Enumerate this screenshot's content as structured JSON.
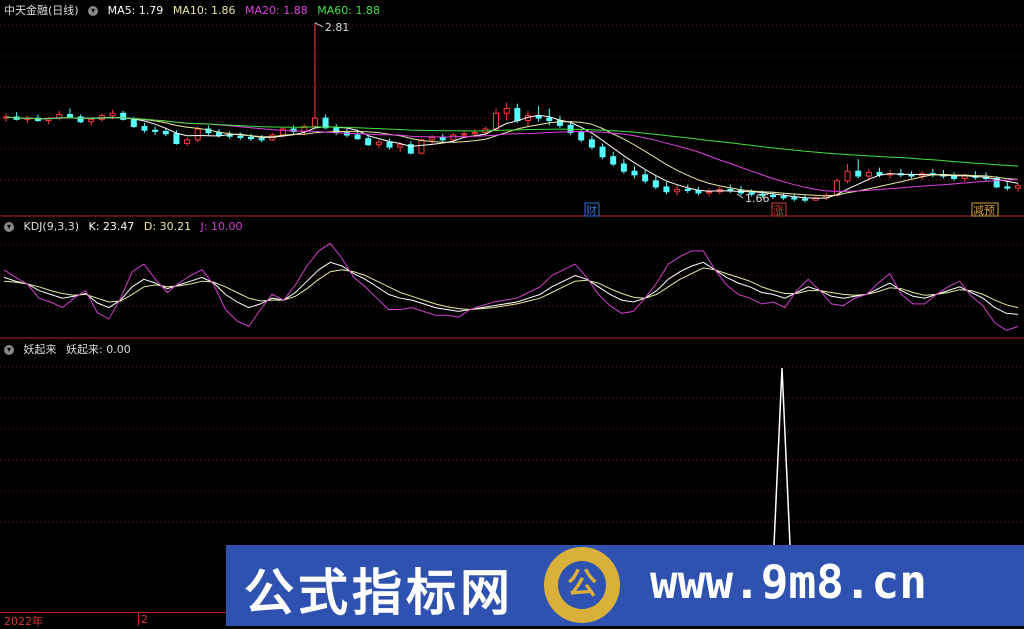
{
  "colors": {
    "up": "#ff3a3a",
    "down": "#54ffff",
    "ma5": "#ffffff",
    "ma10": "#e8e8a0",
    "ma20": "#e040e0",
    "ma60": "#40e040",
    "grid": "#7a1818",
    "panel_border": "#b22222",
    "kdj_k": "#ffffff",
    "kdj_d": "#e8e8a0",
    "kdj_j": "#d040d0"
  },
  "main_panel": {
    "title": "中天金融(日线)",
    "ma5_label": "MA5: 1.79",
    "ma10_label": "MA10: 1.86",
    "ma20_label": "MA20: 1.88",
    "ma60_label": "MA60: 1.88",
    "high_marker": "2.81",
    "low_marker": "1.66",
    "tags": [
      "财",
      "涨",
      "减预"
    ]
  },
  "kdj_panel": {
    "title": "KDJ(9,3,3)",
    "k_label": "K: 23.47",
    "d_label": "D: 30.21",
    "j_label": "J: 10.00"
  },
  "yao_panel": {
    "title": "妖起来",
    "value_label": "妖起来: 0.00"
  },
  "date_axis": {
    "year_label": "2022年",
    "month_label": "2"
  },
  "banner": {
    "cn_text": "公式指标网",
    "en_text": "www.9m8.cn",
    "logo_glyph": "公",
    "logo_subtext": "www.9m8.cn"
  },
  "chart_data": {
    "type": "candlestick",
    "ohlc": [
      [
        2.02,
        2.06,
        1.99,
        2.03
      ],
      [
        2.03,
        2.07,
        2.0,
        2.01
      ],
      [
        2.01,
        2.04,
        1.98,
        2.02
      ],
      [
        2.02,
        2.05,
        1.99,
        2.0
      ],
      [
        2.0,
        2.03,
        1.97,
        2.02
      ],
      [
        2.02,
        2.08,
        2.0,
        2.05
      ],
      [
        2.05,
        2.1,
        2.02,
        2.03
      ],
      [
        2.03,
        2.05,
        1.98,
        1.99
      ],
      [
        1.99,
        2.02,
        1.96,
        2.01
      ],
      [
        2.01,
        2.06,
        1.99,
        2.04
      ],
      [
        2.04,
        2.09,
        2.01,
        2.06
      ],
      [
        2.06,
        2.08,
        2.0,
        2.01
      ],
      [
        2.01,
        2.03,
        1.94,
        1.95
      ],
      [
        1.95,
        1.98,
        1.9,
        1.92
      ],
      [
        1.92,
        1.95,
        1.88,
        1.91
      ],
      [
        1.91,
        1.94,
        1.87,
        1.89
      ],
      [
        1.89,
        1.92,
        1.8,
        1.81
      ],
      [
        1.81,
        1.86,
        1.79,
        1.84
      ],
      [
        1.84,
        1.95,
        1.82,
        1.93
      ],
      [
        1.93,
        1.96,
        1.88,
        1.9
      ],
      [
        1.9,
        1.93,
        1.86,
        1.88
      ],
      [
        1.88,
        1.91,
        1.85,
        1.87
      ],
      [
        1.87,
        1.9,
        1.84,
        1.86
      ],
      [
        1.86,
        1.89,
        1.83,
        1.85
      ],
      [
        1.85,
        1.88,
        1.82,
        1.84
      ],
      [
        1.84,
        1.9,
        1.83,
        1.88
      ],
      [
        1.88,
        1.95,
        1.86,
        1.93
      ],
      [
        1.93,
        1.96,
        1.89,
        1.91
      ],
      [
        1.91,
        1.97,
        1.88,
        1.95
      ],
      [
        1.95,
        2.81,
        1.94,
        2.02
      ],
      [
        2.02,
        2.05,
        1.93,
        1.94
      ],
      [
        1.94,
        1.97,
        1.88,
        1.9
      ],
      [
        1.9,
        1.93,
        1.86,
        1.88
      ],
      [
        1.88,
        1.91,
        1.84,
        1.85
      ],
      [
        1.85,
        1.88,
        1.79,
        1.8
      ],
      [
        1.8,
        1.84,
        1.77,
        1.82
      ],
      [
        1.82,
        1.85,
        1.76,
        1.78
      ],
      [
        1.78,
        1.82,
        1.74,
        1.8
      ],
      [
        1.8,
        1.83,
        1.72,
        1.73
      ],
      [
        1.73,
        1.85,
        1.72,
        1.84
      ],
      [
        1.84,
        1.88,
        1.8,
        1.86
      ],
      [
        1.86,
        1.89,
        1.82,
        1.84
      ],
      [
        1.84,
        1.9,
        1.83,
        1.88
      ],
      [
        1.88,
        1.91,
        1.85,
        1.89
      ],
      [
        1.89,
        1.93,
        1.86,
        1.9
      ],
      [
        1.9,
        1.95,
        1.88,
        1.93
      ],
      [
        1.93,
        2.1,
        1.91,
        2.06
      ],
      [
        2.06,
        2.15,
        2.0,
        2.1
      ],
      [
        2.1,
        2.14,
        1.98,
        2.0
      ],
      [
        2.0,
        2.08,
        1.95,
        2.04
      ],
      [
        2.04,
        2.12,
        1.99,
        2.02
      ],
      [
        2.02,
        2.1,
        1.96,
        2.0
      ],
      [
        2.0,
        2.04,
        1.94,
        1.96
      ],
      [
        1.96,
        1.99,
        1.88,
        1.9
      ],
      [
        1.9,
        1.93,
        1.82,
        1.84
      ],
      [
        1.84,
        1.87,
        1.76,
        1.78
      ],
      [
        1.78,
        1.81,
        1.68,
        1.7
      ],
      [
        1.7,
        1.74,
        1.62,
        1.64
      ],
      [
        1.64,
        1.68,
        1.56,
        1.58
      ],
      [
        1.58,
        1.62,
        1.52,
        1.55
      ],
      [
        1.55,
        1.59,
        1.48,
        1.5
      ],
      [
        1.5,
        1.54,
        1.43,
        1.45
      ],
      [
        1.45,
        1.49,
        1.39,
        1.41
      ],
      [
        1.41,
        1.46,
        1.38,
        1.43
      ],
      [
        1.43,
        1.47,
        1.4,
        1.42
      ],
      [
        1.42,
        1.45,
        1.38,
        1.4
      ],
      [
        1.4,
        1.44,
        1.37,
        1.41
      ],
      [
        1.41,
        1.45,
        1.39,
        1.43
      ],
      [
        1.43,
        1.47,
        1.4,
        1.42
      ],
      [
        1.42,
        1.46,
        1.38,
        1.4
      ],
      [
        1.4,
        1.43,
        1.37,
        1.39
      ],
      [
        1.39,
        1.42,
        1.36,
        1.38
      ],
      [
        1.38,
        1.41,
        1.35,
        1.37
      ],
      [
        1.37,
        1.4,
        1.34,
        1.36
      ],
      [
        1.36,
        1.39,
        1.33,
        1.35
      ],
      [
        1.35,
        1.38,
        1.32,
        1.34
      ],
      [
        1.34,
        1.37,
        1.66,
        1.36
      ],
      [
        1.36,
        1.4,
        1.34,
        1.38
      ],
      [
        1.38,
        1.52,
        1.37,
        1.5
      ],
      [
        1.5,
        1.64,
        1.48,
        1.58
      ],
      [
        1.58,
        1.68,
        1.52,
        1.54
      ],
      [
        1.54,
        1.6,
        1.5,
        1.57
      ],
      [
        1.57,
        1.61,
        1.53,
        1.55
      ],
      [
        1.55,
        1.59,
        1.52,
        1.56
      ],
      [
        1.56,
        1.6,
        1.53,
        1.55
      ],
      [
        1.55,
        1.58,
        1.52,
        1.54
      ],
      [
        1.54,
        1.58,
        1.51,
        1.56
      ],
      [
        1.56,
        1.6,
        1.53,
        1.55
      ],
      [
        1.55,
        1.59,
        1.52,
        1.54
      ],
      [
        1.54,
        1.57,
        1.5,
        1.52
      ],
      [
        1.52,
        1.56,
        1.49,
        1.54
      ],
      [
        1.54,
        1.58,
        1.51,
        1.53
      ],
      [
        1.53,
        1.57,
        1.5,
        1.52
      ],
      [
        1.52,
        1.54,
        1.44,
        1.45
      ],
      [
        1.45,
        1.49,
        1.42,
        1.44
      ],
      [
        1.44,
        1.48,
        1.41,
        1.46
      ]
    ],
    "kdj_k": [
      62,
      58,
      55,
      48,
      44,
      40,
      42,
      45,
      35,
      30,
      38,
      52,
      60,
      56,
      50,
      54,
      58,
      62,
      56,
      44,
      36,
      30,
      34,
      40,
      38,
      46,
      58,
      70,
      78,
      74,
      66,
      60,
      52,
      44,
      40,
      38,
      34,
      30,
      28,
      26,
      28,
      30,
      32,
      34,
      36,
      40,
      44,
      52,
      58,
      64,
      60,
      52,
      44,
      38,
      36,
      40,
      48,
      60,
      68,
      74,
      78,
      70,
      62,
      56,
      52,
      46,
      44,
      40,
      46,
      52,
      48,
      42,
      40,
      42,
      44,
      50,
      56,
      48,
      42,
      40,
      44,
      48,
      52,
      46,
      40,
      30,
      24,
      23
    ],
    "kdj_d": [
      58,
      57,
      55,
      52,
      48,
      45,
      43,
      44,
      40,
      36,
      37,
      44,
      52,
      54,
      52,
      53,
      55,
      58,
      57,
      52,
      46,
      40,
      37,
      38,
      38,
      42,
      50,
      60,
      68,
      70,
      68,
      64,
      58,
      52,
      46,
      42,
      38,
      34,
      31,
      29,
      28,
      29,
      30,
      32,
      34,
      37,
      40,
      46,
      52,
      58,
      59,
      56,
      50,
      45,
      41,
      40,
      44,
      52,
      60,
      66,
      72,
      70,
      66,
      62,
      58,
      52,
      48,
      45,
      45,
      48,
      48,
      46,
      44,
      43,
      44,
      47,
      51,
      50,
      46,
      43,
      44,
      46,
      49,
      48,
      44,
      38,
      33,
      30
    ],
    "kdj_j": [
      70,
      62,
      55,
      40,
      36,
      30,
      40,
      48,
      25,
      18,
      40,
      68,
      76,
      60,
      46,
      56,
      64,
      70,
      54,
      28,
      16,
      10,
      28,
      44,
      38,
      54,
      74,
      90,
      98,
      82,
      62,
      52,
      40,
      28,
      28,
      30,
      26,
      22,
      22,
      20,
      28,
      32,
      36,
      38,
      40,
      46,
      52,
      64,
      70,
      76,
      62,
      44,
      32,
      24,
      26,
      40,
      56,
      76,
      84,
      90,
      90,
      70,
      54,
      44,
      40,
      34,
      36,
      30,
      48,
      60,
      48,
      34,
      32,
      40,
      44,
      56,
      66,
      44,
      34,
      34,
      44,
      52,
      58,
      42,
      32,
      14,
      6,
      10
    ],
    "yao": {
      "spike_index": 1,
      "spike_value": 1
    }
  }
}
